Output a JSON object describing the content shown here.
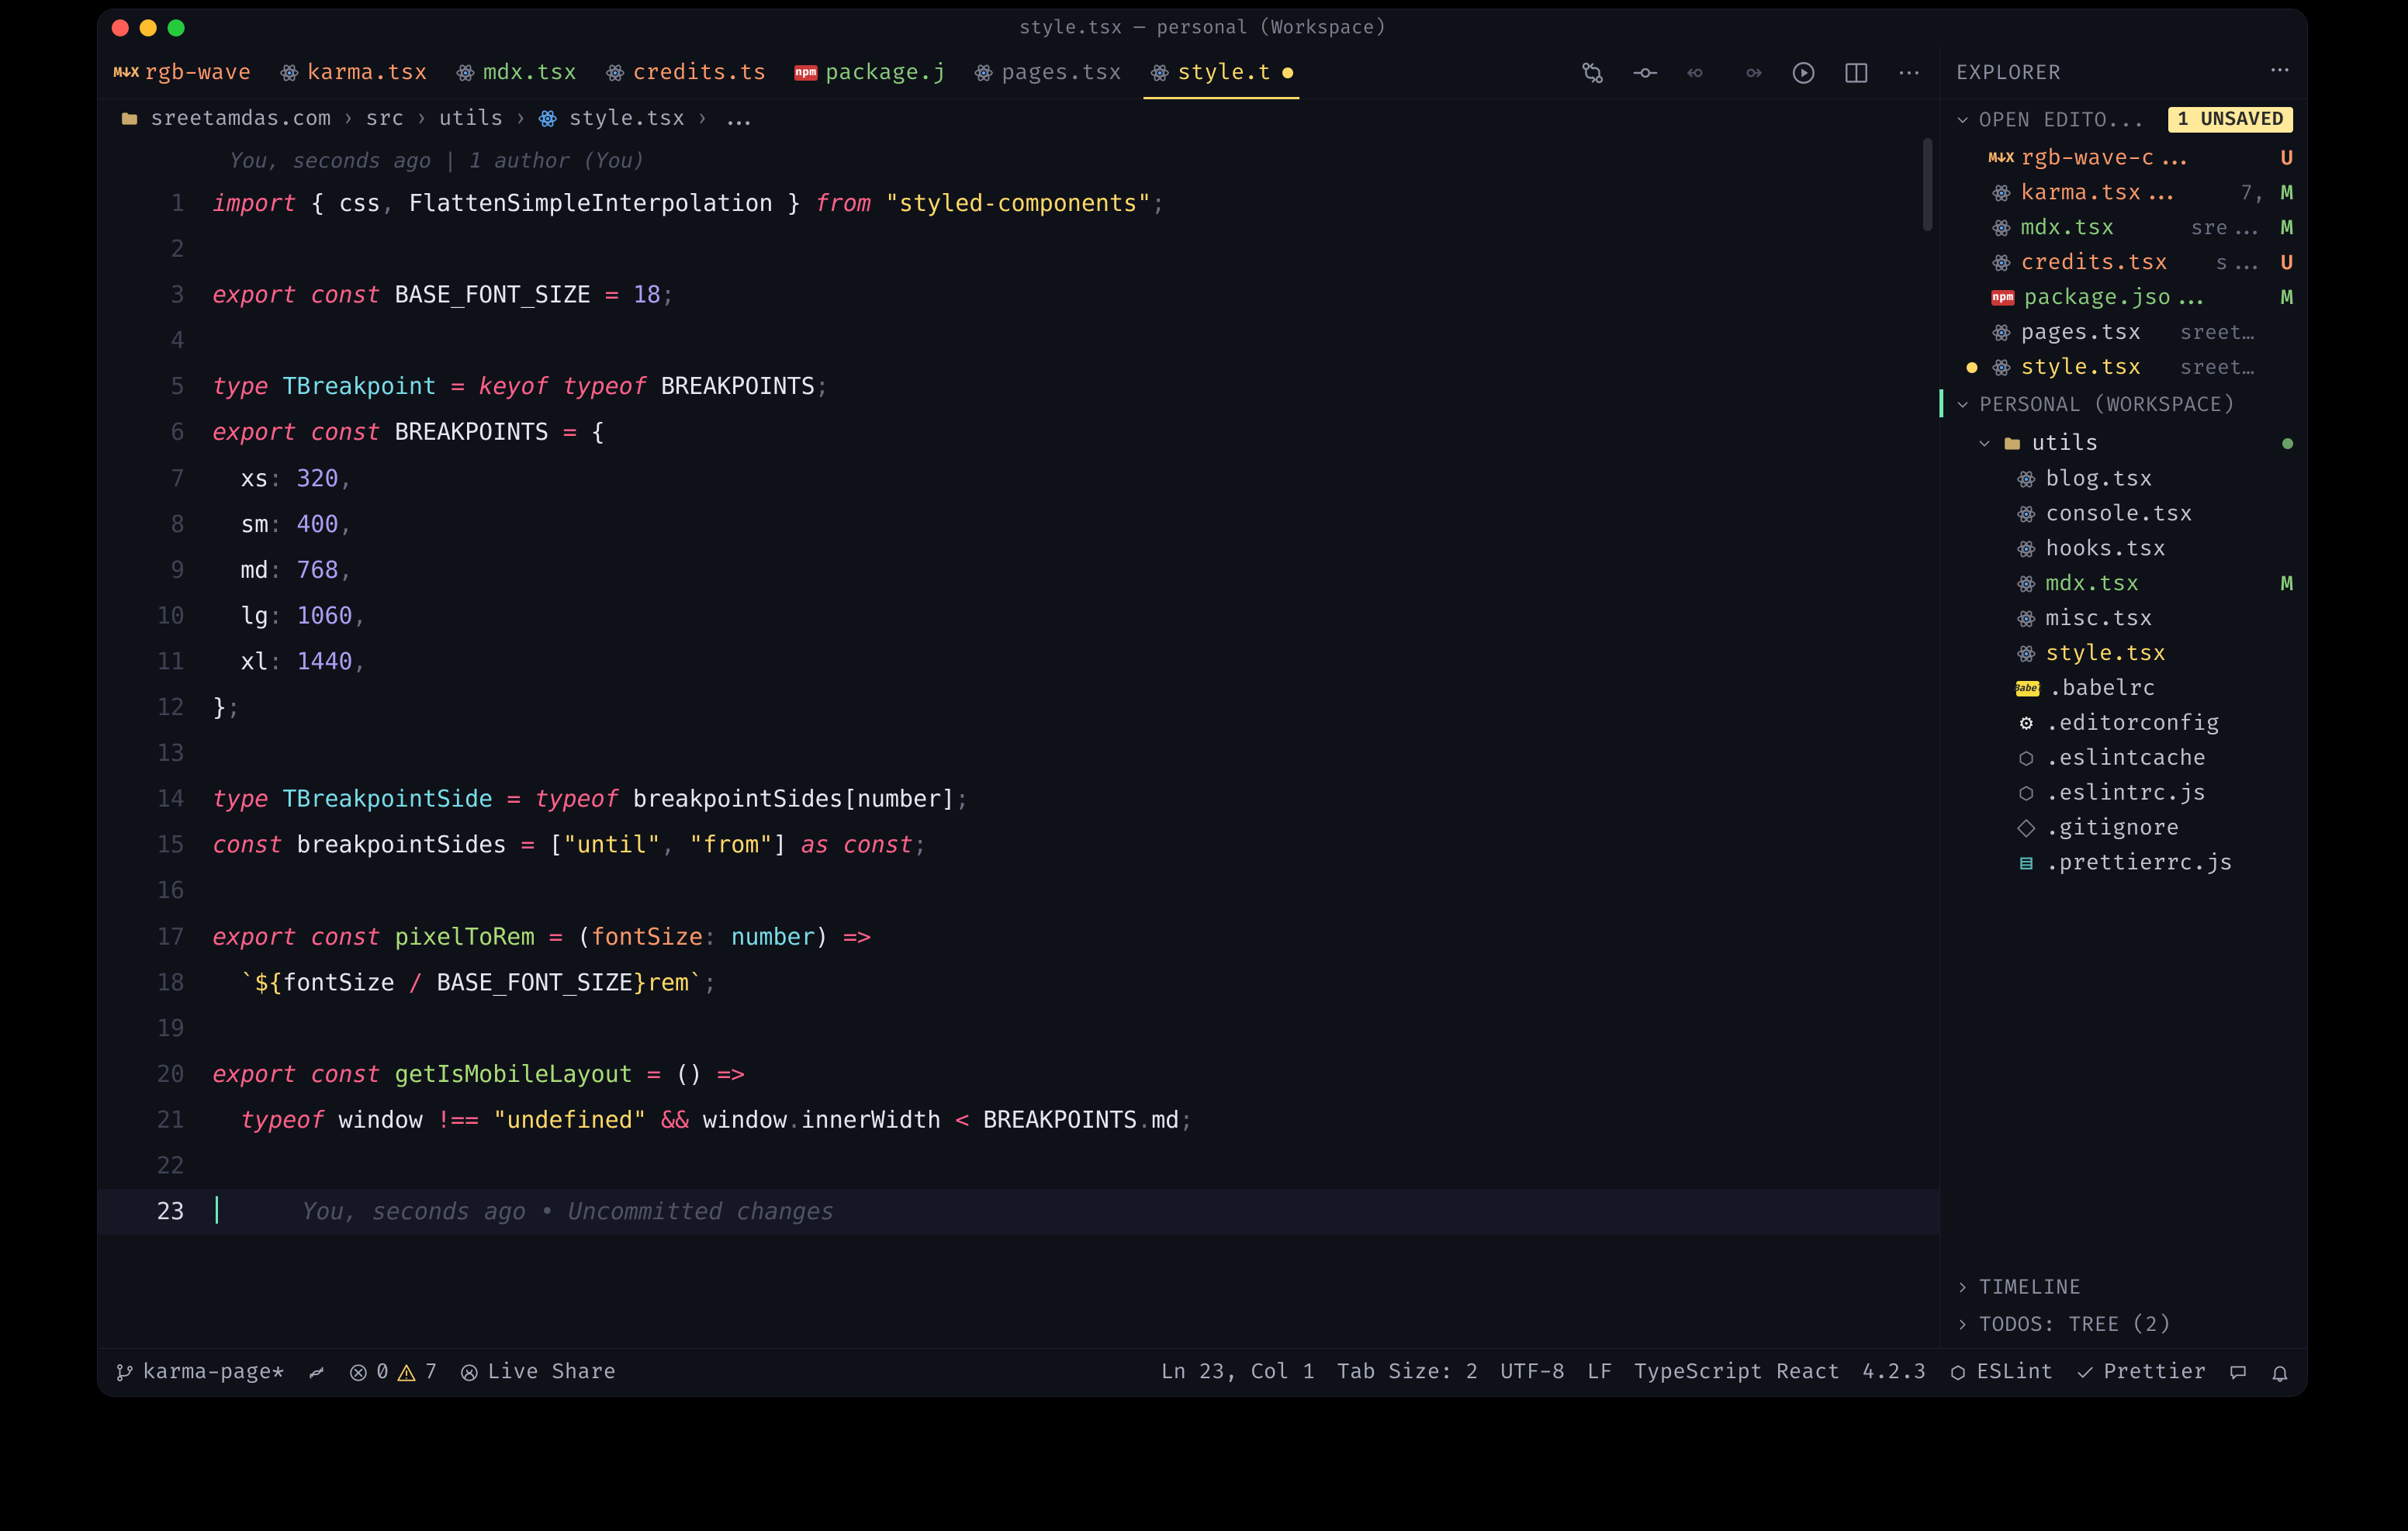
{
  "window_title": "style.tsx — personal (Workspace)",
  "tabs": [
    {
      "id": "rgb",
      "label": "rgb-wave",
      "iconType": "mdx"
    },
    {
      "id": "karma",
      "label": "karma.tsx",
      "iconType": "react"
    },
    {
      "id": "mdxts",
      "label": "mdx.tsx",
      "iconType": "react"
    },
    {
      "id": "credits",
      "label": "credits.ts",
      "iconType": "react"
    },
    {
      "id": "pkg",
      "label": "package.j",
      "iconType": "npm"
    },
    {
      "id": "pages",
      "label": "pages.tsx",
      "iconType": "react"
    },
    {
      "id": "style",
      "label": "style.t",
      "iconType": "react",
      "dirty": true,
      "active": true
    }
  ],
  "breadcrumb": {
    "parts": [
      "sreetamdas.com",
      "src",
      "utils",
      "style.tsx",
      "..."
    ]
  },
  "blame": "You, seconds ago | 1 author (You)",
  "gitlens_inline": "You, seconds ago • Uncommitted changes",
  "sidebar": {
    "title": "EXPLORER",
    "openEditors": {
      "label": "OPEN EDITO...",
      "unsaved_badge": "1 UNSAVED",
      "items": [
        {
          "label": "rgb-wave-c...",
          "iconType": "mdx",
          "status": "U",
          "color": "orange"
        },
        {
          "label": "karma.tsx...",
          "suffix": "7,",
          "iconType": "react",
          "status": "M",
          "color": "orange"
        },
        {
          "label": "mdx.tsx",
          "suffix": "sre...",
          "iconType": "react",
          "status": "M",
          "color": "green"
        },
        {
          "label": "credits.tsx",
          "suffix": "s...",
          "iconType": "react",
          "status": "U",
          "color": "orange"
        },
        {
          "label": "package.jso...",
          "iconType": "npm",
          "status": "M",
          "color": "green"
        },
        {
          "label": "pages.tsx",
          "suffix": "sreeta...",
          "iconType": "react",
          "color": "dim"
        },
        {
          "label": "style.tsx",
          "suffix": "sreetamd...",
          "iconType": "react",
          "color": "yellow",
          "dirty": true
        }
      ]
    },
    "workspace": {
      "label": "PERSONAL (WORKSPACE)",
      "folder": {
        "name": "utils"
      },
      "files": [
        {
          "label": "blog.tsx",
          "iconType": "react"
        },
        {
          "label": "console.tsx",
          "iconType": "react"
        },
        {
          "label": "hooks.tsx",
          "iconType": "react"
        },
        {
          "label": "mdx.tsx",
          "iconType": "react",
          "status": "M",
          "color": "green"
        },
        {
          "label": "misc.tsx",
          "iconType": "react"
        },
        {
          "label": "style.tsx",
          "iconType": "react",
          "color": "yellow"
        },
        {
          "label": ".babelrc",
          "iconType": "babel"
        },
        {
          "label": ".editorconfig",
          "iconType": "editorconfig"
        },
        {
          "label": ".eslintcache",
          "iconType": "eslint"
        },
        {
          "label": ".eslintrc.js",
          "iconType": "eslint"
        },
        {
          "label": ".gitignore",
          "iconType": "git"
        },
        {
          "label": ".prettierrc.js",
          "iconType": "prettier"
        }
      ]
    },
    "bottom": [
      {
        "label": "TIMELINE"
      },
      {
        "label": "TODOS: TREE (2)"
      }
    ]
  },
  "status": {
    "branch": "karma-page*",
    "errors": "0",
    "warnings": "7",
    "liveshare": "Live Share",
    "position": "Ln 23, Col 1",
    "tabsize": "Tab Size: 2",
    "encoding": "UTF-8",
    "eol": "LF",
    "lang": "TypeScript React",
    "tsver": "4.2.3",
    "eslint": "ESLint",
    "prettier": "Prettier"
  },
  "code": {
    "lines": [
      {
        "n": 1,
        "tokens": [
          [
            "pink",
            "import"
          ],
          [
            "wht",
            " { "
          ],
          [
            "wht",
            "css"
          ],
          [
            "dim",
            ", "
          ],
          [
            "wht",
            "FlattenSimpleInterpolation"
          ],
          [
            "wht",
            " } "
          ],
          [
            "pink",
            "from"
          ],
          [
            "wht",
            " "
          ],
          [
            "yel",
            "\"styled-components\""
          ],
          [
            "dim",
            ";"
          ]
        ]
      },
      {
        "n": 2,
        "tokens": []
      },
      {
        "n": 3,
        "tokens": [
          [
            "pink",
            "export"
          ],
          [
            "wht",
            " "
          ],
          [
            "pink",
            "const"
          ],
          [
            "wht",
            " "
          ],
          [
            "wht",
            "BASE_FONT_SIZE"
          ],
          [
            "wht",
            " "
          ],
          [
            "pink-std",
            "="
          ],
          [
            "wht",
            " "
          ],
          [
            "pur",
            "18"
          ],
          [
            "dim",
            ";"
          ]
        ]
      },
      {
        "n": 4,
        "tokens": []
      },
      {
        "n": 5,
        "tokens": [
          [
            "pink",
            "type"
          ],
          [
            "wht",
            " "
          ],
          [
            "cy",
            "TBreakpoint"
          ],
          [
            "wht",
            " "
          ],
          [
            "pink-std",
            "="
          ],
          [
            "wht",
            " "
          ],
          [
            "pink",
            "keyof"
          ],
          [
            "wht",
            " "
          ],
          [
            "pink",
            "typeof"
          ],
          [
            "wht",
            " "
          ],
          [
            "wht",
            "BREAKPOINTS"
          ],
          [
            "dim",
            ";"
          ]
        ]
      },
      {
        "n": 6,
        "tokens": [
          [
            "pink",
            "export"
          ],
          [
            "wht",
            " "
          ],
          [
            "pink",
            "const"
          ],
          [
            "wht",
            " "
          ],
          [
            "wht",
            "BREAKPOINTS"
          ],
          [
            "wht",
            " "
          ],
          [
            "pink-std",
            "="
          ],
          [
            "wht",
            " {"
          ]
        ]
      },
      {
        "n": 7,
        "tokens": [
          [
            "wht",
            "  xs"
          ],
          [
            "dim",
            ": "
          ],
          [
            "pur",
            "320"
          ],
          [
            "dim",
            ","
          ]
        ]
      },
      {
        "n": 8,
        "tokens": [
          [
            "wht",
            "  sm"
          ],
          [
            "dim",
            ": "
          ],
          [
            "pur",
            "400"
          ],
          [
            "dim",
            ","
          ]
        ]
      },
      {
        "n": 9,
        "tokens": [
          [
            "wht",
            "  md"
          ],
          [
            "dim",
            ": "
          ],
          [
            "pur",
            "768"
          ],
          [
            "dim",
            ","
          ]
        ]
      },
      {
        "n": 10,
        "tokens": [
          [
            "wht",
            "  lg"
          ],
          [
            "dim",
            ": "
          ],
          [
            "pur",
            "1060"
          ],
          [
            "dim",
            ","
          ]
        ]
      },
      {
        "n": 11,
        "tokens": [
          [
            "wht",
            "  xl"
          ],
          [
            "dim",
            ": "
          ],
          [
            "pur",
            "1440"
          ],
          [
            "dim",
            ","
          ]
        ]
      },
      {
        "n": 12,
        "tokens": [
          [
            "wht",
            "}"
          ],
          [
            "dim",
            ";"
          ]
        ]
      },
      {
        "n": 13,
        "tokens": []
      },
      {
        "n": 14,
        "tokens": [
          [
            "pink",
            "type"
          ],
          [
            "wht",
            " "
          ],
          [
            "cy",
            "TBreakpointSide"
          ],
          [
            "wht",
            " "
          ],
          [
            "pink-std",
            "="
          ],
          [
            "wht",
            " "
          ],
          [
            "pink",
            "typeof"
          ],
          [
            "wht",
            " "
          ],
          [
            "wht",
            "breakpointSides"
          ],
          [
            "wht",
            "["
          ],
          [
            "wht",
            "number"
          ],
          [
            "wht",
            "]"
          ],
          [
            "dim",
            ";"
          ]
        ]
      },
      {
        "n": 15,
        "tokens": [
          [
            "pink",
            "const"
          ],
          [
            "wht",
            " "
          ],
          [
            "wht",
            "breakpointSides"
          ],
          [
            "wht",
            " "
          ],
          [
            "pink-std",
            "="
          ],
          [
            "wht",
            " ["
          ],
          [
            "yel",
            "\"until\""
          ],
          [
            "dim",
            ", "
          ],
          [
            "yel",
            "\"from\""
          ],
          [
            "wht",
            "] "
          ],
          [
            "pink",
            "as"
          ],
          [
            "wht",
            " "
          ],
          [
            "pink",
            "const"
          ],
          [
            "dim",
            ";"
          ]
        ]
      },
      {
        "n": 16,
        "tokens": []
      },
      {
        "n": 17,
        "tokens": [
          [
            "pink",
            "export"
          ],
          [
            "wht",
            " "
          ],
          [
            "pink",
            "const"
          ],
          [
            "wht",
            " "
          ],
          [
            "grn",
            "pixelToRem"
          ],
          [
            "wht",
            " "
          ],
          [
            "pink-std",
            "="
          ],
          [
            "wht",
            " ("
          ],
          [
            "org",
            "fontSize"
          ],
          [
            "dim",
            ": "
          ],
          [
            "cy",
            "number"
          ],
          [
            "wht",
            ") "
          ],
          [
            "pink-std",
            "=>"
          ]
        ]
      },
      {
        "n": 18,
        "tokens": [
          [
            "wht",
            "  "
          ],
          [
            "yel",
            "`${"
          ],
          [
            "wht",
            "fontSize "
          ],
          [
            "pink-std",
            "/"
          ],
          [
            "wht",
            " BASE_FONT_SIZE"
          ],
          [
            "yel",
            "}rem`"
          ],
          [
            "dim",
            ";"
          ]
        ]
      },
      {
        "n": 19,
        "tokens": []
      },
      {
        "n": 20,
        "tokens": [
          [
            "pink",
            "export"
          ],
          [
            "wht",
            " "
          ],
          [
            "pink",
            "const"
          ],
          [
            "wht",
            " "
          ],
          [
            "grn",
            "getIsMobileLayout"
          ],
          [
            "wht",
            " "
          ],
          [
            "pink-std",
            "="
          ],
          [
            "wht",
            " () "
          ],
          [
            "pink-std",
            "=>"
          ]
        ]
      },
      {
        "n": 21,
        "tokens": [
          [
            "wht",
            "  "
          ],
          [
            "pink",
            "typeof"
          ],
          [
            "wht",
            " window "
          ],
          [
            "pink-std",
            "!=="
          ],
          [
            "wht",
            " "
          ],
          [
            "yel",
            "\"undefined\""
          ],
          [
            "wht",
            " "
          ],
          [
            "pink-std",
            "&&"
          ],
          [
            "wht",
            " window"
          ],
          [
            "dim",
            "."
          ],
          [
            "wht",
            "innerWidth "
          ],
          [
            "pink-std",
            "<"
          ],
          [
            "wht",
            " BREAKPOINTS"
          ],
          [
            "dim",
            "."
          ],
          [
            "wht",
            "md"
          ],
          [
            "dim",
            ";"
          ]
        ]
      },
      {
        "n": 22,
        "tokens": []
      },
      {
        "n": 23,
        "hl": true,
        "cursor": true,
        "tokens": []
      }
    ]
  }
}
